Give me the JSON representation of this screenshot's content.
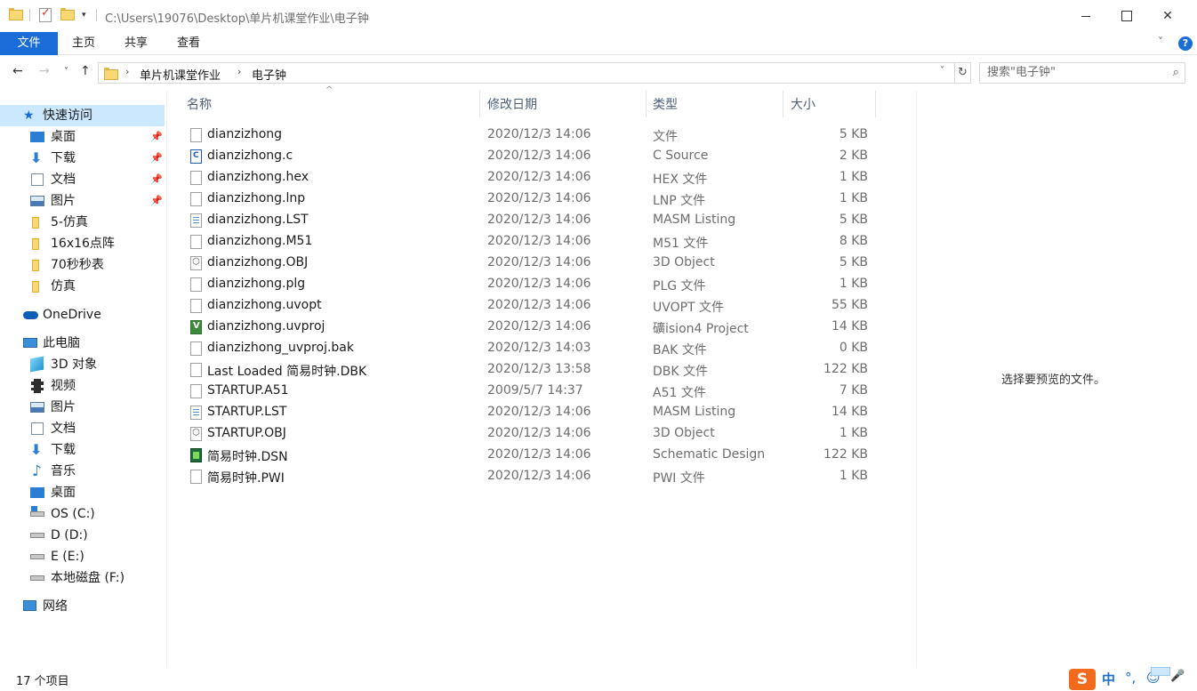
{
  "window": {
    "title_path": "C:\\Users\\19076\\Desktop\\单片机课堂作业\\电子钟",
    "quick_access_dropdown": "▾",
    "minimize": "—",
    "maximize": "☐",
    "close": "✕"
  },
  "ribbon": {
    "tabs": [
      "文件",
      "主页",
      "共享",
      "查看"
    ],
    "expand": "˅",
    "help": "?"
  },
  "nav": {
    "back": "←",
    "forward": "→",
    "recent": "˅",
    "up": "↑",
    "breadcrumb": [
      "单片机课堂作业",
      "电子钟"
    ],
    "crumb_sep": "›",
    "address_dropdown": "˅",
    "refresh": "↻",
    "search_placeholder": "搜索\"电子钟\"",
    "search_icon": "⌕"
  },
  "sidebar": {
    "quick_access": "快速访问",
    "pinned": [
      {
        "label": "桌面",
        "icon": "desktop-icon"
      },
      {
        "label": "下载",
        "icon": "download-icon"
      },
      {
        "label": "文档",
        "icon": "documents-icon"
      },
      {
        "label": "图片",
        "icon": "pictures-icon"
      }
    ],
    "folders": [
      "5-仿真",
      "16x16点阵",
      "70秒秒表",
      "仿真"
    ],
    "onedrive": "OneDrive",
    "this_pc": "此电脑",
    "pc_items": [
      {
        "label": "3D 对象",
        "icon": "3d-objects-icon"
      },
      {
        "label": "视频",
        "icon": "videos-icon"
      },
      {
        "label": "图片",
        "icon": "pictures-icon"
      },
      {
        "label": "文档",
        "icon": "documents-icon"
      },
      {
        "label": "下载",
        "icon": "download-icon"
      },
      {
        "label": "音乐",
        "icon": "music-icon"
      },
      {
        "label": "桌面",
        "icon": "desktop-icon"
      },
      {
        "label": "OS (C:)",
        "icon": "os-drive-icon"
      },
      {
        "label": "D (D:)",
        "icon": "drive-icon"
      },
      {
        "label": "E (E:)",
        "icon": "drive-icon"
      },
      {
        "label": "本地磁盘 (F:)",
        "icon": "drive-icon"
      }
    ],
    "network": "网络",
    "pin_glyph": "📌"
  },
  "columns": {
    "name": "名称",
    "date": "修改日期",
    "type": "类型",
    "size": "大小",
    "sort_indicator": "^"
  },
  "files": [
    {
      "name": "dianzizhong",
      "date": "2020/12/3 14:06",
      "type": "文件",
      "size": "5 KB",
      "icon": "blank-file-icon"
    },
    {
      "name": "dianzizhong.c",
      "date": "2020/12/3 14:06",
      "type": "C Source",
      "size": "2 KB",
      "icon": "c-source-icon"
    },
    {
      "name": "dianzizhong.hex",
      "date": "2020/12/3 14:06",
      "type": "HEX 文件",
      "size": "1 KB",
      "icon": "blank-file-icon"
    },
    {
      "name": "dianzizhong.lnp",
      "date": "2020/12/3 14:06",
      "type": "LNP 文件",
      "size": "1 KB",
      "icon": "blank-file-icon"
    },
    {
      "name": "dianzizhong.LST",
      "date": "2020/12/3 14:06",
      "type": "MASM Listing",
      "size": "5 KB",
      "icon": "listing-file-icon"
    },
    {
      "name": "dianzizhong.M51",
      "date": "2020/12/3 14:06",
      "type": "M51 文件",
      "size": "8 KB",
      "icon": "blank-file-icon"
    },
    {
      "name": "dianzizhong.OBJ",
      "date": "2020/12/3 14:06",
      "type": "3D Object",
      "size": "5 KB",
      "icon": "3d-object-file-icon"
    },
    {
      "name": "dianzizhong.plg",
      "date": "2020/12/3 14:06",
      "type": "PLG 文件",
      "size": "1 KB",
      "icon": "blank-file-icon"
    },
    {
      "name": "dianzizhong.uvopt",
      "date": "2020/12/3 14:06",
      "type": "UVOPT 文件",
      "size": "55 KB",
      "icon": "blank-file-icon"
    },
    {
      "name": "dianzizhong.uvproj",
      "date": "2020/12/3 14:06",
      "type": "礦ision4 Project",
      "size": "14 KB",
      "icon": "uvision-project-icon"
    },
    {
      "name": "dianzizhong_uvproj.bak",
      "date": "2020/12/3 14:03",
      "type": "BAK 文件",
      "size": "0 KB",
      "icon": "blank-file-icon"
    },
    {
      "name": "Last Loaded 简易时钟.DBK",
      "date": "2020/12/3 13:58",
      "type": "DBK 文件",
      "size": "122 KB",
      "icon": "blank-file-icon"
    },
    {
      "name": "STARTUP.A51",
      "date": "2009/5/7 14:37",
      "type": "A51 文件",
      "size": "7 KB",
      "icon": "blank-file-icon"
    },
    {
      "name": "STARTUP.LST",
      "date": "2020/12/3 14:06",
      "type": "MASM Listing",
      "size": "14 KB",
      "icon": "listing-file-icon"
    },
    {
      "name": "STARTUP.OBJ",
      "date": "2020/12/3 14:06",
      "type": "3D Object",
      "size": "1 KB",
      "icon": "3d-object-file-icon"
    },
    {
      "name": "简易时钟.DSN",
      "date": "2020/12/3 14:06",
      "type": "Schematic Design",
      "size": "122 KB",
      "icon": "schematic-design-icon"
    },
    {
      "name": "简易时钟.PWI",
      "date": "2020/12/3 14:06",
      "type": "PWI 文件",
      "size": "1 KB",
      "icon": "blank-file-icon"
    }
  ],
  "preview": {
    "message": "选择要预览的文件。"
  },
  "status": {
    "item_count": "17 个项目"
  },
  "ime": {
    "logo": "S",
    "lang": "中",
    "punct": "°,",
    "emoji": "☺",
    "mic": "🎤"
  },
  "colors": {
    "accent": "#1a6dd7",
    "selection": "#cce8ff",
    "header_text": "#4c607a",
    "secondary_text": "#6d6d6d"
  }
}
